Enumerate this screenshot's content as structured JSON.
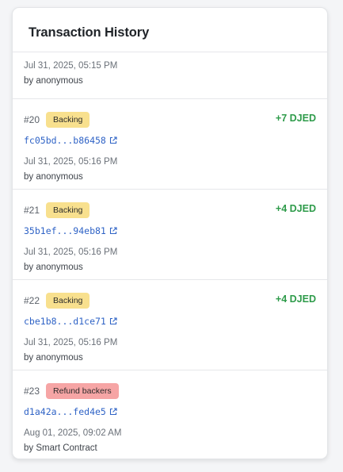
{
  "header": {
    "title": "Transaction History"
  },
  "first": {
    "date": "Jul 31, 2025, 05:15 PM",
    "by": "by anonymous"
  },
  "transactions": [
    {
      "num": "#20",
      "badge": "Backing",
      "badge_type": "backing",
      "amount": "+7 DJED",
      "hash": "fc05bd...b86458",
      "date": "Jul 31, 2025, 05:16 PM",
      "by": "by anonymous"
    },
    {
      "num": "#21",
      "badge": "Backing",
      "badge_type": "backing",
      "amount": "+4 DJED",
      "hash": "35b1ef...94eb81",
      "date": "Jul 31, 2025, 05:16 PM",
      "by": "by anonymous"
    },
    {
      "num": "#22",
      "badge": "Backing",
      "badge_type": "backing",
      "amount": "+4 DJED",
      "hash": "cbe1b8...d1ce71",
      "date": "Jul 31, 2025, 05:16 PM",
      "by": "by anonymous"
    },
    {
      "num": "#23",
      "badge": "Refund backers",
      "badge_type": "refund",
      "amount": "",
      "hash": "d1a42a...fed4e5",
      "date": "Aug 01, 2025, 09:02 AM",
      "by": "by Smart Contract"
    }
  ],
  "colors": {
    "amount": "#2e9b4a",
    "link": "#2f63c6",
    "backing_badge": "#f8e08e",
    "refund_badge": "#f6a5a5"
  },
  "icons": {
    "link": "external-link-icon"
  }
}
